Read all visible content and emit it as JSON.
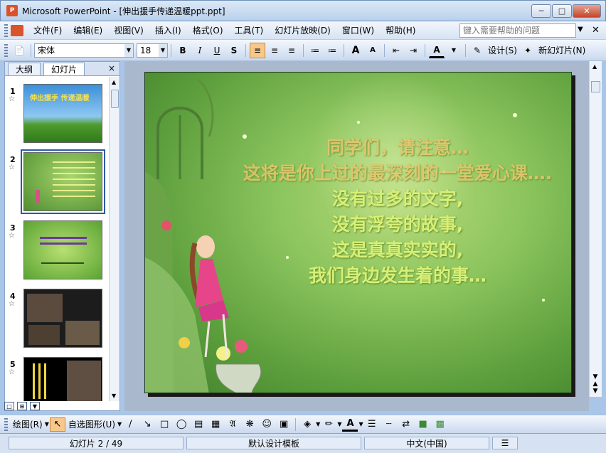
{
  "window": {
    "title": "Microsoft PowerPoint - [伸出援手传递温暖ppt.ppt]",
    "app_icon": "P"
  },
  "menu": {
    "items": [
      "文件(F)",
      "编辑(E)",
      "视图(V)",
      "插入(I)",
      "格式(O)",
      "工具(T)",
      "幻灯片放映(D)",
      "窗口(W)",
      "帮助(H)"
    ],
    "help_placeholder": "键入需要帮助的问题"
  },
  "toolbar": {
    "font_name": "宋体",
    "font_size": "18",
    "bold": "B",
    "italic": "I",
    "underline": "U",
    "shadow": "S",
    "grow_font": "A",
    "shrink_font": "A",
    "font_color": "A",
    "design_label": "设计(S)",
    "new_slide_label": "新幻灯片(N)"
  },
  "panel": {
    "tabs": [
      "大纲",
      "幻灯片"
    ],
    "close": "×",
    "slides": [
      {
        "num": "1",
        "title": "伸出援手 传递温暖"
      },
      {
        "num": "2"
      },
      {
        "num": "3"
      },
      {
        "num": "4"
      },
      {
        "num": "5"
      }
    ]
  },
  "slide": {
    "lines": [
      "同学们，请注意…",
      "这将是你上过的最深刻的一堂爱心课….",
      "没有过多的文字,",
      "没有浮夸的故事,",
      "这是真真实实的,",
      "我们身边发生着的事…"
    ]
  },
  "drawbar": {
    "draw_label": "绘图(R)",
    "autoshape_label": "自选图形(U)"
  },
  "status": {
    "slide_count": "幻灯片 2 / 49",
    "template": "默认设计模板",
    "language": "中文(中国)"
  },
  "colors": {
    "accent": "#2b5aa6",
    "slide_text": "#d8ef76",
    "active_button": "#f7c88a"
  }
}
